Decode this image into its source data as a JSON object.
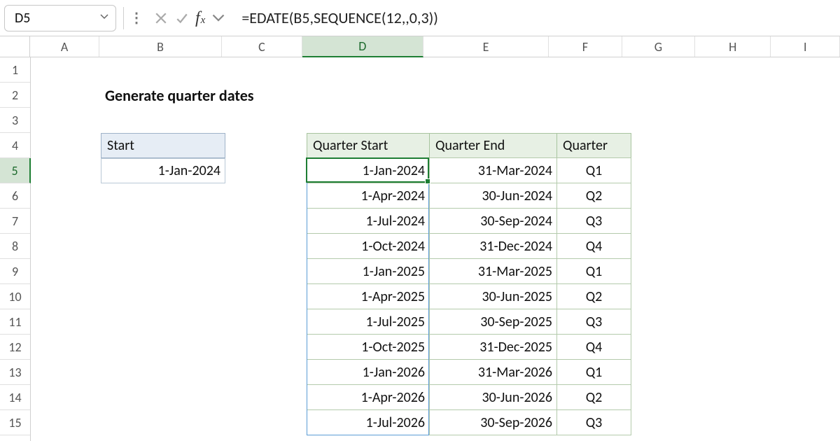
{
  "formula_bar": {
    "cell_reference": "D5",
    "formula": "=EDATE(B5,SEQUENCE(12,,0,3))"
  },
  "columns": [
    "A",
    "B",
    "C",
    "D",
    "E",
    "F",
    "G",
    "H",
    "I"
  ],
  "column_widths": {
    "A": 100,
    "B": 178,
    "C": 116,
    "D": 176,
    "E": 182,
    "F": 106,
    "G": 106,
    "H": 110,
    "I": 100
  },
  "rows": [
    1,
    2,
    3,
    4,
    5,
    6,
    7,
    8,
    9,
    10,
    11,
    12,
    13,
    14,
    15
  ],
  "row_heights": {
    "1": 36,
    "2": 36,
    "3": 36,
    "4": 36,
    "default": 36
  },
  "title": "Generate quarter dates",
  "start_label": "Start",
  "start_value": "1-Jan-2024",
  "table_headers": {
    "d": "Quarter Start",
    "e": "Quarter End",
    "f": "Quarter"
  },
  "table_rows": [
    {
      "start": "1-Jan-2024",
      "end": "31-Mar-2024",
      "q": "Q1"
    },
    {
      "start": "1-Apr-2024",
      "end": "30-Jun-2024",
      "q": "Q2"
    },
    {
      "start": "1-Jul-2024",
      "end": "30-Sep-2024",
      "q": "Q3"
    },
    {
      "start": "1-Oct-2024",
      "end": "31-Dec-2024",
      "q": "Q4"
    },
    {
      "start": "1-Jan-2025",
      "end": "31-Mar-2025",
      "q": "Q1"
    },
    {
      "start": "1-Apr-2025",
      "end": "30-Jun-2025",
      "q": "Q2"
    },
    {
      "start": "1-Jul-2025",
      "end": "30-Sep-2025",
      "q": "Q3"
    },
    {
      "start": "1-Oct-2025",
      "end": "31-Dec-2025",
      "q": "Q4"
    },
    {
      "start": "1-Jan-2026",
      "end": "31-Mar-2026",
      "q": "Q1"
    },
    {
      "start": "1-Apr-2026",
      "end": "30-Jun-2026",
      "q": "Q2"
    },
    {
      "start": "1-Jul-2026",
      "end": "30-Sep-2026",
      "q": "Q3"
    }
  ],
  "selected": {
    "col": "D",
    "row": 5
  }
}
